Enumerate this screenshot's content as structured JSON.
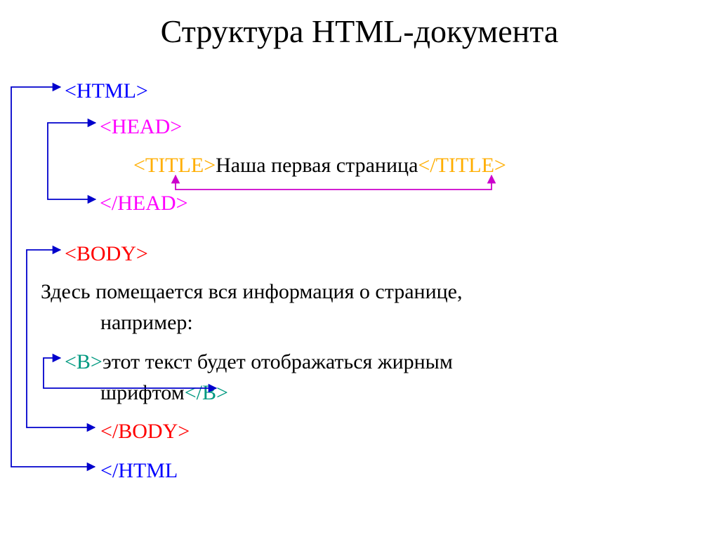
{
  "title": "Структура HTML-документа",
  "tags": {
    "html_open": "<HTML>",
    "head_open": "<HEAD>",
    "title_open": "<TITLE>",
    "title_text": "Наша первая страница",
    "title_close": "</TITLE>",
    "head_close": "</HEAD>",
    "body_open": "<BODY>",
    "body_text1a": "Здесь помещается вся информация о странице,",
    "body_text1b": "например:",
    "b_open": "<B>",
    "b_text1": "этот текст будет отображаться жирным",
    "b_text2": "шрифтом",
    "b_close": "</B>",
    "body_close": "</BODY>",
    "html_close": "</HTML"
  },
  "colors": {
    "html": "#0000ff",
    "head": "#ff00ff",
    "title": "#ffae00",
    "body": "#ff0000",
    "b": "#009980",
    "text": "#000000",
    "arrow_blue": "#0000cc",
    "arrow_magenta": "#cc00cc"
  }
}
